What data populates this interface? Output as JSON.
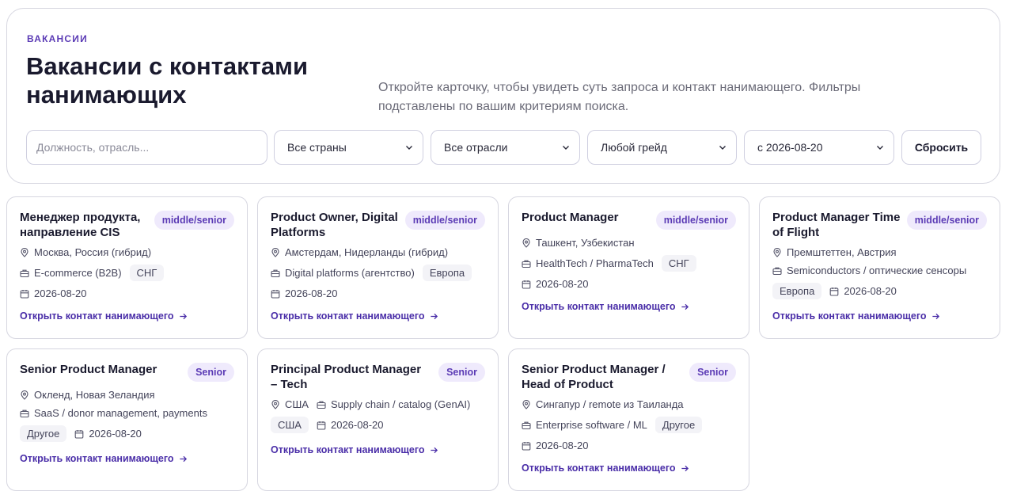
{
  "header": {
    "eyebrow": "ВАКАНСИИ",
    "title": "Вакансии с контактами нанимающих",
    "intro": "Откройте карточку, чтобы увидеть суть запроса и контакт нанимающего. Фильтры подставлены по вашим критериям поиска."
  },
  "filters": {
    "search_placeholder": "Должность, отрасль...",
    "country": "Все страны",
    "industry": "Все отрасли",
    "grade": "Любой грейд",
    "date": "с 2026-08-20",
    "reset": "Сбросить"
  },
  "link_label": "Открыть контакт нанимающего",
  "jobs": [
    {
      "title": "Менеджер продукта, направление CIS",
      "grade": "middle/senior",
      "location": "Москва, Россия (гибрид)",
      "industry": "E-commerce (B2B)",
      "region": "СНГ",
      "date": "2026-08-20"
    },
    {
      "title": "Product Owner, Digital Platforms",
      "grade": "middle/senior",
      "location": "Амстердам, Нидерланды (гибрид)",
      "industry": "Digital platforms (агентство)",
      "region": "Европа",
      "date": "2026-08-20"
    },
    {
      "title": "Product Manager",
      "grade": "middle/senior",
      "location": "Ташкент, Узбекистан",
      "industry": "HealthTech / PharmaTech",
      "region": "СНГ",
      "date": "2026-08-20"
    },
    {
      "title": "Product Manager Time of Flight",
      "grade": "middle/senior",
      "location": "Премштеттен, Австрия",
      "industry": "Semiconductors / оптические сенсоры",
      "region": "Европа",
      "date": "2026-08-20"
    },
    {
      "title": "Senior Product Manager",
      "grade": "Senior",
      "location": "Окленд, Новая Зеландия",
      "industry": "SaaS / donor management, payments",
      "region": "Другое",
      "date": "2026-08-20"
    },
    {
      "title": "Principal Product Manager – Tech",
      "grade": "Senior",
      "location": "США",
      "industry": "Supply chain / catalog (GenAI)",
      "region": "США",
      "date": "2026-08-20"
    },
    {
      "title": "Senior Product Manager / Head of Product",
      "grade": "Senior",
      "location": "Сингапур / remote из Таиланда",
      "industry": "Enterprise software / ML",
      "region": "Другое",
      "date": "2026-08-20"
    }
  ],
  "icons": {
    "location": "map-pin-icon",
    "industry": "briefcase-icon",
    "date": "calendar-icon",
    "link": "arrow-right-icon",
    "select": "chevron-down-icon"
  },
  "colors": {
    "accent": "#5b3bb5",
    "badge_bg": "#efeafc",
    "border": "#d6d6e0",
    "tag_bg": "#f3f3f7"
  }
}
